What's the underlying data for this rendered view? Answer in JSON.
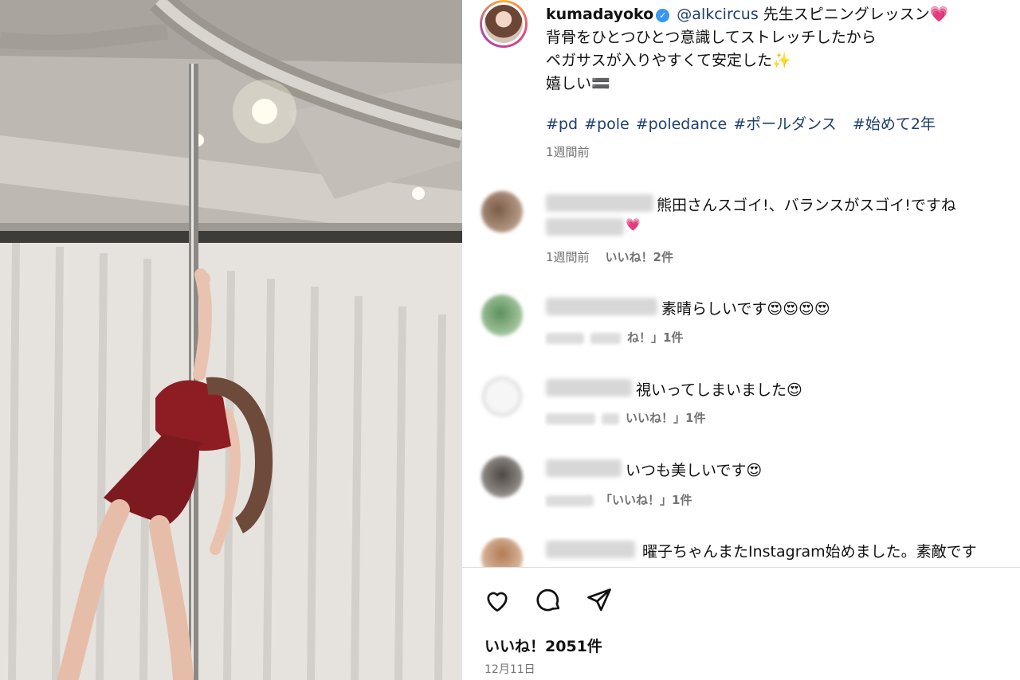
{
  "post": {
    "username": "kumadayoko",
    "verified_icon": "verified-badge-icon",
    "mention": "@alkcircus",
    "caption_line1_rest": "先生スピニングレッスン💗",
    "caption_line2": "背骨をひとつひとつ意識してストレッチしたから",
    "caption_line3": "ペガサスが入りやすくて安定した✨",
    "caption_line4": "嬉しい🟰",
    "hashtags": [
      "#pd",
      "#pole",
      "#poledance",
      "#ポールダンス",
      "#始めて2年"
    ],
    "time": "1週間前"
  },
  "comments": [
    {
      "text": "熊田さんスゴイ!、バランスがスゴイ!ですね",
      "text2": "💗",
      "time": "1週間前",
      "likes": "いいね！2件"
    },
    {
      "text": "素晴らしいです😍😍😍😍",
      "likes": "ね！」1件"
    },
    {
      "text": "視いってしまいました😍",
      "likes": "いいね！」1件"
    },
    {
      "text": "いつも美しいです😍",
      "likes": "「いいね！」1件"
    },
    {
      "text": "曜子ちゃんまたInstagram始めました。素敵です"
    }
  ],
  "actions": {
    "like_icon": "heart-icon",
    "comment_icon": "comment-icon",
    "share_icon": "share-icon"
  },
  "footer": {
    "likes": "いいね！2051件",
    "date": "12月11日"
  },
  "colors": {
    "link": "#1f3f6e",
    "meta": "#737373",
    "verified": "#3897f0"
  }
}
